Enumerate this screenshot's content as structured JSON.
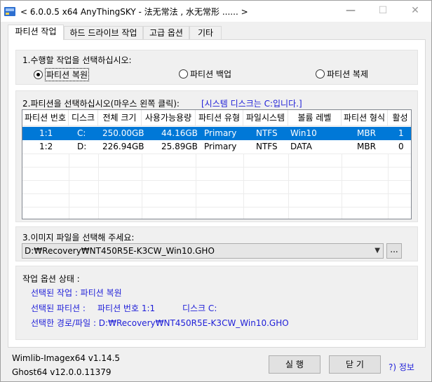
{
  "window": {
    "title": "< 6.0.0.5 x64 AnyThingSKY - 法无常法 , 水无常形 ...... >",
    "minimize": "—",
    "maximize": "☐",
    "close": "✕"
  },
  "tabs": [
    "파티션 작업",
    "하드 드라이브 작업",
    "고급 옵션",
    "기타"
  ],
  "task_group": {
    "label": "1.수행할 작업을 선택하십시오:",
    "options": [
      "파티션 복원",
      "파티션 백업",
      "파티션 복제"
    ],
    "selected": "파티션 복원"
  },
  "partition_group": {
    "label": "2.파티션을 선택하십시오(마우스 왼쪽 클릭):",
    "note": "[시스템 디스크는 C:입니다.]",
    "columns": [
      "파티션 번호",
      "디스크",
      "전체 크기",
      "사용가능용량",
      "파티션 유형",
      "파일시스템",
      "볼륨 레벨",
      "파티션 형식",
      "활성"
    ],
    "rows": [
      [
        "1:1",
        "C:",
        "250.00GB",
        "44.16GB",
        "Primary",
        "NTFS",
        "Win10",
        "MBR",
        "1"
      ],
      [
        "1:2",
        "D:",
        "226.94GB",
        "25.89GB",
        "Primary",
        "NTFS",
        "DATA",
        "MBR",
        "0"
      ]
    ]
  },
  "image_group": {
    "label": "3.이미지 파일을 선택해 주세요:",
    "path": "D:₩Recovery₩NT450R5E-K3CW_Win10.GHO",
    "browse": "..."
  },
  "status_group": {
    "label": "작업 옵션 상태 :",
    "selected_task": "선택된 작업 : 파티션 복원",
    "selected_partition_label": "선택된 파티션 :",
    "selected_partition_value": "파티션 번호 1:1",
    "selected_disk": "디스크 C:",
    "selected_path": "선택한 경로/파일 : D:₩Recovery₩NT450R5E-K3CW_Win10.GHO"
  },
  "footer": {
    "wimlib": "Wimlib-Imagex64 v1.14.5",
    "ghost": "Ghost64 v12.0.0.11379",
    "run": "실 행",
    "close": "닫 기",
    "info": "?) 정보"
  }
}
